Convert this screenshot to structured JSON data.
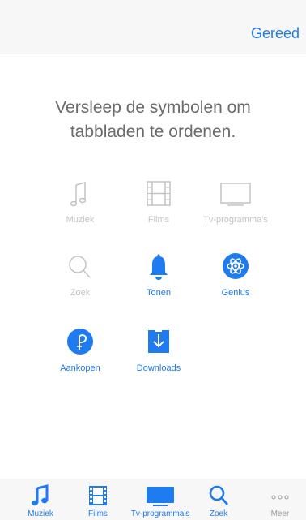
{
  "navbar": {
    "done_label": "Gereed"
  },
  "instructions": {
    "line1": "Versleep de symbolen om",
    "line2": "tabbladen te ordenen."
  },
  "grid": {
    "muziek": "Muziek",
    "films": "Films",
    "tv": "Tv-programma's",
    "zoek": "Zoek",
    "tonen": "Tonen",
    "genius": "Genius",
    "aankopen": "Aankopen",
    "downloads": "Downloads"
  },
  "tabbar": {
    "muziek": "Muziek",
    "films": "Films",
    "tv": "Tv-programma's",
    "zoek": "Zoek",
    "meer": "Meer"
  },
  "colors": {
    "accent": "#1e7bf0",
    "disabled": "#c4c4c4",
    "bar_bg": "#f7f7f7"
  }
}
